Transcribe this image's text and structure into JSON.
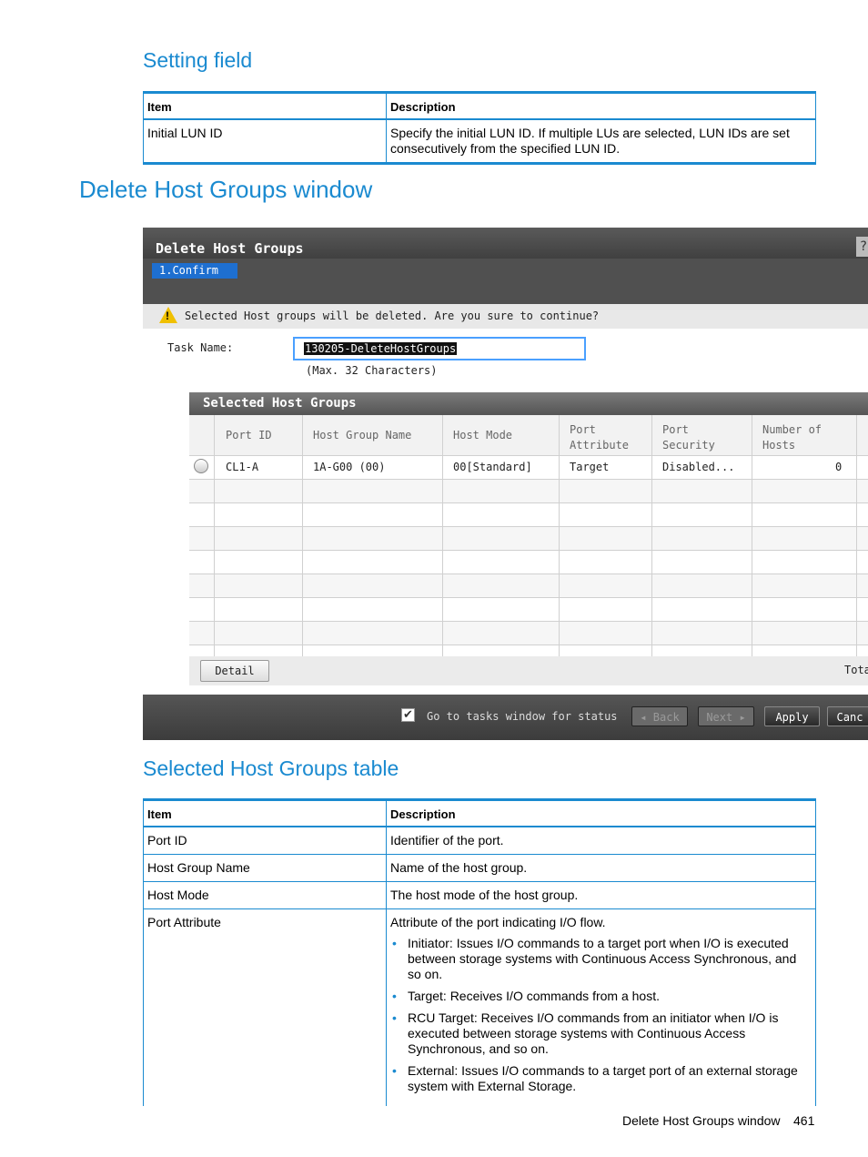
{
  "section1": {
    "heading": "Setting field",
    "columns": [
      "Item",
      "Description"
    ],
    "rows": [
      {
        "item": "Initial LUN ID",
        "description": "Specify the initial LUN ID. If multiple LUs are selected, LUN IDs are set consecutively from the specified LUN ID."
      }
    ]
  },
  "main_heading": "Delete Host Groups window",
  "screenshot": {
    "title": "Delete Host Groups",
    "step": "1.Confirm",
    "warning": "Selected Host groups will be deleted. Are you sure to continue?",
    "task_label": "Task Name:",
    "task_value": "130205-DeleteHostGroups",
    "task_hint": "(Max. 32 Characters)",
    "panel_title": "Selected Host Groups",
    "columns": {
      "port_id": "Port ID",
      "host_group_name": "Host Group Name",
      "host_mode": "Host Mode",
      "port_attribute_1": "Port",
      "port_attribute_2": "Attribute",
      "port_security_1": "Port",
      "port_security_2": "Security",
      "number_of_hosts_1": "Number of",
      "number_of_hosts_2": "Hosts"
    },
    "row": {
      "port_id": "CL1-A",
      "host_group_name": "1A-G00 (00)",
      "host_mode": "00[Standard]",
      "port_attribute": "Target",
      "port_security": "Disabled...",
      "number_of_hosts": "0"
    },
    "detail_button": "Detail",
    "total_label": "Tota",
    "checkbox_label": "Go to tasks window for status",
    "back_button": "Back",
    "next_button": "Next",
    "apply_button": "Apply",
    "cancel_button": "Canc"
  },
  "section2": {
    "heading": "Selected Host Groups table",
    "columns": [
      "Item",
      "Description"
    ],
    "rows": [
      {
        "item": "Port ID",
        "description": "Identifier of the port."
      },
      {
        "item": "Host Group Name",
        "description": "Name of the host group."
      },
      {
        "item": "Host Mode",
        "description": "The host mode of the host group."
      },
      {
        "item": "Port Attribute",
        "description": "Attribute of the port indicating I/O flow.",
        "bullets": [
          "Initiator: Issues I/O commands to a target port when I/O is executed between storage systems with Continuous Access Synchronous, and so on.",
          "Target: Receives I/O commands from a host.",
          "RCU Target: Receives I/O commands from an initiator when I/O is executed between storage systems with Continuous Access Synchronous, and so on.",
          "External: Issues I/O commands to a target port of an external storage system with External Storage."
        ]
      }
    ]
  },
  "footer": {
    "text": "Delete Host Groups window",
    "page": "461"
  }
}
